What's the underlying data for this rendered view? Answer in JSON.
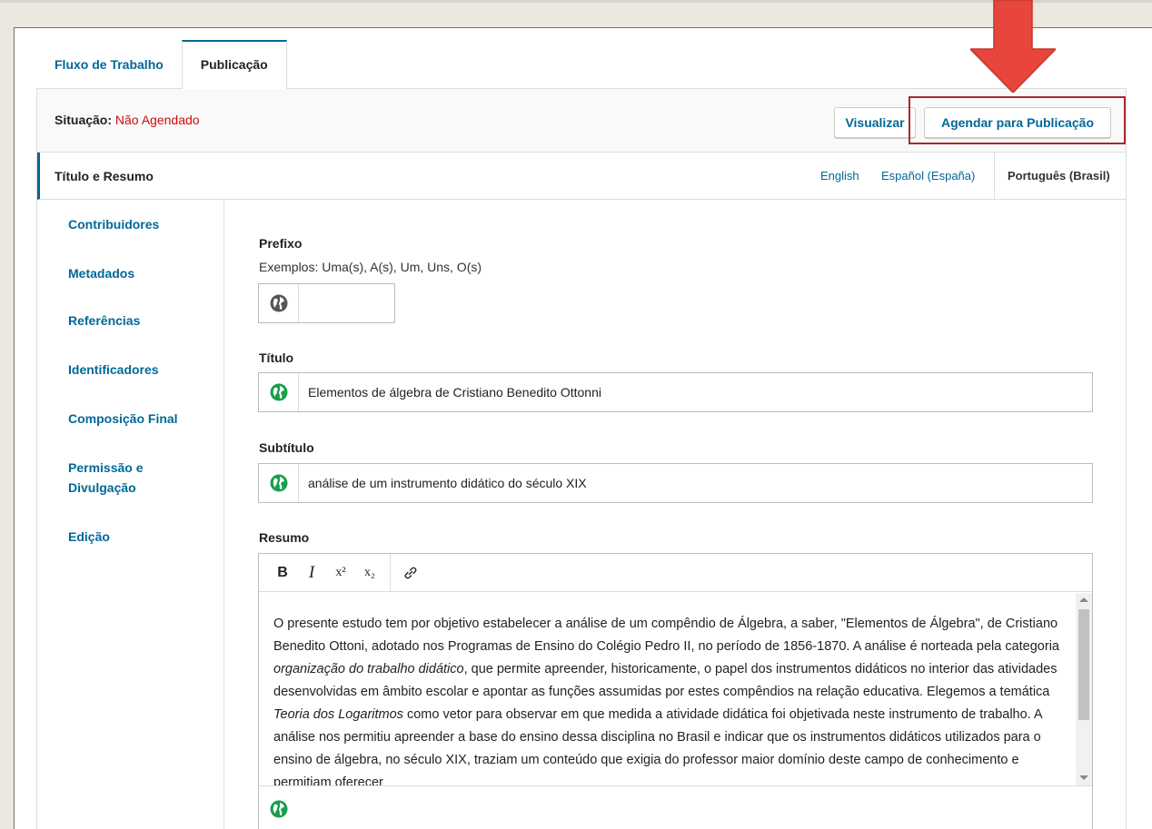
{
  "tabs": [
    {
      "label": "Fluxo de Trabalho",
      "active": false
    },
    {
      "label": "Publicação",
      "active": true
    }
  ],
  "status": {
    "label": "Situação:",
    "value": "Não Agendado",
    "value_color": "#d00a0a"
  },
  "actions": {
    "preview": "Visualizar",
    "schedule": "Agendar para Publicação"
  },
  "sidenav": {
    "items": [
      {
        "label": "Título e Resumo",
        "active": true
      },
      {
        "label": "Contribuidores"
      },
      {
        "label": "Metadados"
      },
      {
        "label": "Referências"
      },
      {
        "label": "Identificadores"
      },
      {
        "label": "Composição Final"
      },
      {
        "label": "Permissão e",
        "label2": "Divulgação"
      },
      {
        "label": "Edição"
      }
    ]
  },
  "locales": [
    "English",
    "Español (España)",
    "Português (Brasil)"
  ],
  "active_locale": "Português (Brasil)",
  "form": {
    "prefix": {
      "label": "Prefixo",
      "description": "Exemplos: Uma(s), A(s), Um, Uns, O(s)",
      "value": ""
    },
    "title": {
      "label": "Título",
      "value": "Elementos de álgebra de Cristiano Benedito Ottonni"
    },
    "subtitle": {
      "label": "Subtítulo",
      "value": "análise de um instrumento didático do século XIX"
    },
    "abstract": {
      "label": "Resumo",
      "toolbar": [
        "B",
        "I",
        "x²",
        "x₂",
        "link"
      ],
      "text_parts": [
        {
          "t": "O presente estudo tem por objetivo estabelecer a análise de um compêndio de Álgebra, a saber, \"Elementos de Álgebra\", de Cristiano Benedito Ottoni, adotado nos Programas de Ensino do Colégio Pedro II, no período de 1856-1870. A análise é norteada pela categoria "
        },
        {
          "t": "organização do trabalho didático",
          "i": true
        },
        {
          "t": ", que permite apreender, historicamente, o papel dos instrumentos didáticos no interior das atividades desenvolvidas em âmbito escolar e apontar as funções assumidas por estes compêndios na relação educativa. Elegemos a temática "
        },
        {
          "t": "Teoria dos Logaritmos",
          "i": true
        },
        {
          "t": " como vetor para observar em que medida a atividade didática foi objetivada neste instrumento de trabalho. A análise nos permitiu apreender a base do ensino dessa disciplina no Brasil e indicar que os instrumentos didáticos utilizados para o ensino de álgebra, no século XIX, traziam um conteúdo que exigia do professor maior domínio deste campo de conhecimento e permitiam oferecer"
        }
      ]
    }
  },
  "colors": {
    "accent": "#006798",
    "status": "#d00a0a",
    "arrow": "#e8453c",
    "highlight": "#a52a2a",
    "globe_active": "#1a9e4b",
    "globe_inactive": "#555555"
  },
  "icons": {
    "globe": "globe-icon",
    "link": "link-icon"
  }
}
